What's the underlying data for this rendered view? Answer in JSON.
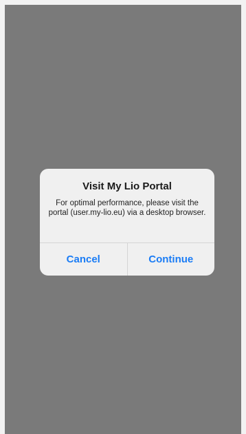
{
  "alert": {
    "title": "Visit My Lio Portal",
    "message": "For optimal performance, please visit the portal (user.my-lio.eu) via a desktop browser.",
    "cancel_label": "Cancel",
    "continue_label": "Continue"
  },
  "colors": {
    "overlay": "#7a7a7a",
    "alert_background": "#f0f0f0",
    "button_text": "#1a7cf5"
  }
}
